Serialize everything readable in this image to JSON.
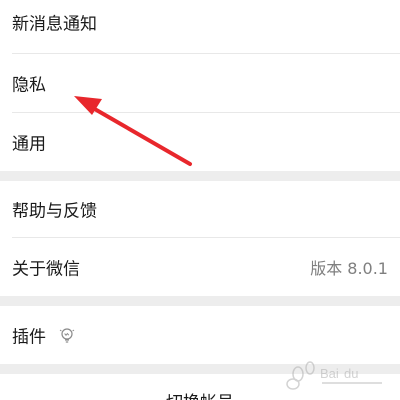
{
  "settings": {
    "items": [
      {
        "label": "新消息通知"
      },
      {
        "label": "隐私"
      },
      {
        "label": "通用"
      },
      {
        "label": "帮助与反馈"
      },
      {
        "label": "关于微信",
        "value": "版本 8.0.1"
      },
      {
        "label": "插件"
      }
    ],
    "switch_account": "切换帐号"
  },
  "icons": {
    "plugin": "lightbulb-icon",
    "annotation": "red-arrow",
    "watermark": "baidu-logo"
  },
  "colors": {
    "background": "#ffffff",
    "section_gap": "#ededed",
    "arrow": "#e8272c",
    "text": "#1a1a1a",
    "secondary_text": "#7f7f7f"
  }
}
